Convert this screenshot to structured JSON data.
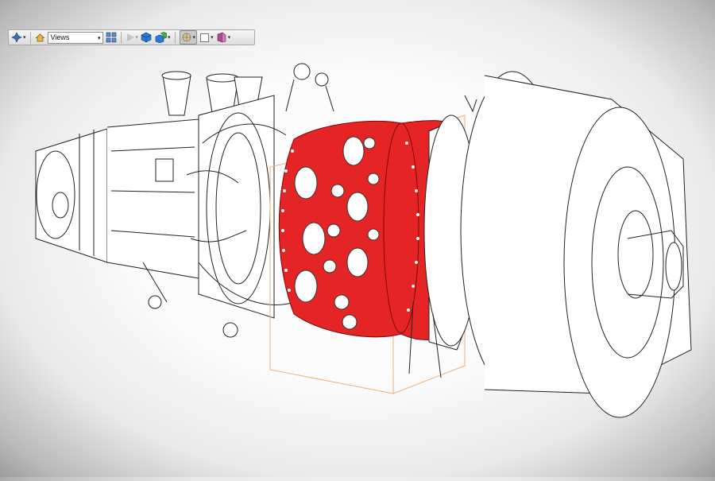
{
  "toolbar": {
    "views_label": "Views",
    "items": [
      {
        "icon": "navigate-icon"
      },
      {
        "icon": "home-icon"
      },
      {
        "icon": "view-list-icon"
      },
      {
        "icon": "play-icon"
      },
      {
        "icon": "cube-icon"
      },
      {
        "icon": "cube-group-icon"
      },
      {
        "icon": "explode-icon"
      },
      {
        "icon": "box-outline-icon"
      },
      {
        "icon": "section-icon"
      }
    ]
  },
  "model": {
    "subject": "gas turbine engine drawing",
    "highlight_color": "#e52426",
    "bounding_box_color": "#f0b07a"
  }
}
